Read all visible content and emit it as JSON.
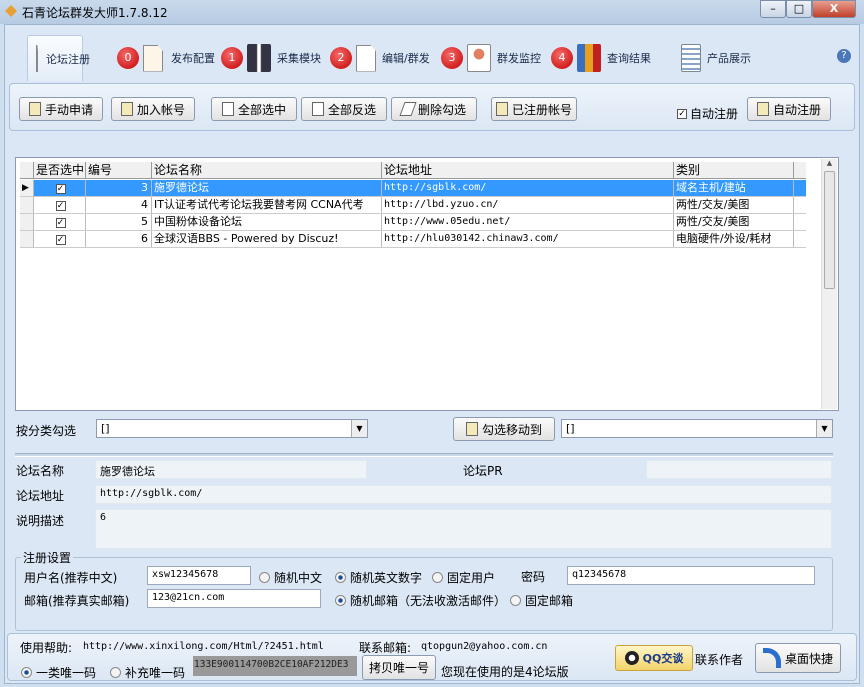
{
  "window": {
    "title": "石青论坛群发大师1.7.8.12",
    "minimize": "–",
    "maximize": "□",
    "close": "X"
  },
  "tabs": [
    {
      "label": "论坛注册",
      "active": true
    },
    {
      "badge": "0",
      "label": "发布配置"
    },
    {
      "badge": "1",
      "label": "采集模块"
    },
    {
      "badge": "2",
      "label": "编辑/群发"
    },
    {
      "badge": "3",
      "label": "群发监控"
    },
    {
      "badge": "4",
      "label": "查询结果"
    },
    {
      "label": "产品展示"
    }
  ],
  "help_icon": "?",
  "toolbar": {
    "manual_apply": "手动申请",
    "add_account": "加入帐号",
    "select_all": "全部选中",
    "invert_select": "全部反选",
    "delete_checked": "删除勾选",
    "registered_accounts": "已注册帐号",
    "auto_register_checkbox": "自动注册",
    "auto_register_checked": true,
    "auto_register_button": "自动注册"
  },
  "grid": {
    "columns": [
      "是否选中",
      "编号",
      "论坛名称",
      "论坛地址",
      "类别"
    ],
    "rows": [
      {
        "checked": true,
        "id": "3",
        "name": "施罗德论坛",
        "url": "http://sgblk.com/",
        "category": "域名主机/建站",
        "selected": true
      },
      {
        "checked": true,
        "id": "4",
        "name": " IT认证考试代考论坛我要替考网 CCNA代考",
        "url": "http://lbd.yzuo.cn/",
        "category": "两性/交友/美图"
      },
      {
        "checked": true,
        "id": "5",
        "name": "中国粉体设备论坛",
        "url": "http://www.05edu.net/",
        "category": "两性/交友/美图"
      },
      {
        "checked": true,
        "id": "6",
        "name": " 全球汉语BBS  - Powered by Discuz!",
        "url": "http://hlu030142.chinaw3.com/",
        "category": "电脑硬件/外设/耗材"
      }
    ]
  },
  "filter": {
    "label": "按分类勾选",
    "value": "[]",
    "move_button": "勾选移动到",
    "target_value": "[]"
  },
  "detail": {
    "name_label": "论坛名称",
    "name_value": "施罗德论坛",
    "pr_label": "论坛PR",
    "pr_value": "",
    "url_label": "论坛地址",
    "url_value": "http://sgblk.com/",
    "desc_label": "说明描述",
    "desc_value": "6"
  },
  "register": {
    "group_title": "注册设置",
    "username_label": "用户名(推荐中文)",
    "username_value": "xsw12345678",
    "opt_random_cn": "随机中文",
    "opt_random_en": "随机英文数字",
    "opt_fixed_user": "固定用户",
    "username_mode": "随机英文数字",
    "password_label": "密码",
    "password_value": "q12345678",
    "email_label": "邮箱(推荐真实邮箱)",
    "email_value": "123@21cn.com",
    "opt_random_email": "随机邮箱（无法收激活邮件）",
    "opt_fixed_email": "固定邮箱",
    "email_mode": "随机邮箱"
  },
  "footer": {
    "help_label": "使用帮助:",
    "help_url": "http://www.xinxilong.com/Html/?2451.html",
    "contact_label": "联系邮箱:",
    "contact_email": "qtopgun2@yahoo.com.cn",
    "opt_class_code": "一类唯一码",
    "opt_extra_code": "补充唯一码",
    "code_mode": "一类唯一码",
    "code_value": "133E900114700B2CE10AF212DE3",
    "copy_button": "拷贝唯一号",
    "version_text": "您现在使用的是4论坛版",
    "qq_button": "QQ交谈",
    "contact_author": "联系作者",
    "desktop_shortcut": "桌面快捷"
  }
}
